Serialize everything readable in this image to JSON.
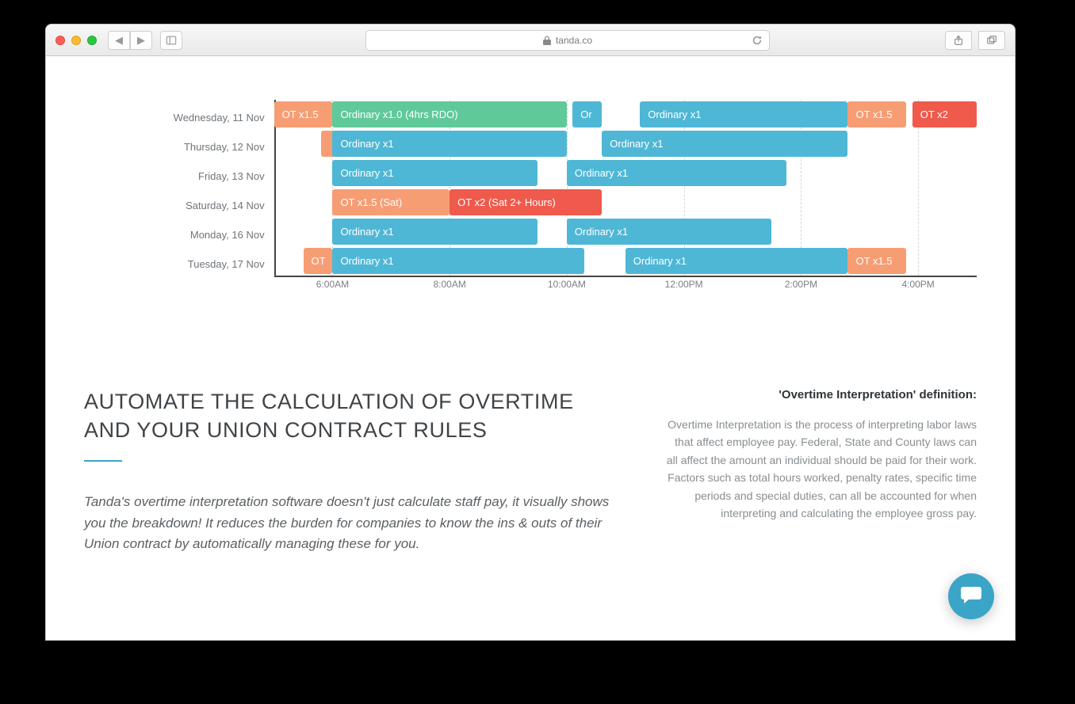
{
  "browser": {
    "url_host": "tanda.co",
    "new_tab": "+"
  },
  "chart_data": {
    "type": "gantt",
    "x_unit": "time",
    "x_range_hours": [
      5,
      17
    ],
    "time_ticks": [
      "6:00AM",
      "8:00AM",
      "10:00AM",
      "12:00PM",
      "2:00PM",
      "4:00PM"
    ],
    "time_tick_hours": [
      6,
      8,
      10,
      12,
      14,
      16
    ],
    "colors": {
      "ordinary": "#4fb7d6",
      "ot15": "#f79d74",
      "ot2": "#ef5a4c",
      "rdo": "#5fc99a"
    },
    "rows": [
      {
        "label": "Wednesday, 11 Nov",
        "bars": [
          {
            "label": "OT x1.5",
            "start": 5.0,
            "end": 6.0,
            "color": "ot15"
          },
          {
            "label": "Ordinary x1.0 (4hrs RDO)",
            "start": 6.0,
            "end": 10.0,
            "color": "rdo"
          },
          {
            "label": "Or",
            "start": 10.1,
            "end": 10.6,
            "color": "ordinary"
          },
          {
            "label": "Ordinary x1",
            "start": 11.25,
            "end": 14.8,
            "color": "ordinary"
          },
          {
            "label": "OT x1.5",
            "start": 14.8,
            "end": 15.8,
            "color": "ot15"
          },
          {
            "label": "OT x2",
            "start": 15.9,
            "end": 17.0,
            "color": "ot2"
          }
        ]
      },
      {
        "label": "Thursday, 12 Nov",
        "bars": [
          {
            "label": "",
            "start": 5.8,
            "end": 6.0,
            "color": "ot15"
          },
          {
            "label": "Ordinary x1",
            "start": 6.0,
            "end": 10.0,
            "color": "ordinary"
          },
          {
            "label": "Ordinary x1",
            "start": 10.6,
            "end": 14.8,
            "color": "ordinary"
          }
        ]
      },
      {
        "label": "Friday, 13 Nov",
        "bars": [
          {
            "label": "Ordinary x1",
            "start": 6.0,
            "end": 9.5,
            "color": "ordinary"
          },
          {
            "label": "Ordinary x1",
            "start": 10.0,
            "end": 13.75,
            "color": "ordinary"
          }
        ]
      },
      {
        "label": "Saturday, 14 Nov",
        "bars": [
          {
            "label": "OT x1.5 (Sat)",
            "start": 6.0,
            "end": 8.0,
            "color": "ot15"
          },
          {
            "label": "OT x2 (Sat 2+ Hours)",
            "start": 8.0,
            "end": 10.6,
            "color": "ot2"
          }
        ]
      },
      {
        "label": "Monday, 16 Nov",
        "bars": [
          {
            "label": "Ordinary x1",
            "start": 6.0,
            "end": 9.5,
            "color": "ordinary"
          },
          {
            "label": "Ordinary x1",
            "start": 10.0,
            "end": 13.5,
            "color": "ordinary"
          }
        ]
      },
      {
        "label": "Tuesday, 17 Nov",
        "bars": [
          {
            "label": "OT",
            "start": 5.5,
            "end": 6.0,
            "color": "ot15"
          },
          {
            "label": "Ordinary x1",
            "start": 6.0,
            "end": 10.3,
            "color": "ordinary"
          },
          {
            "label": "Ordinary x1",
            "start": 11.0,
            "end": 14.8,
            "color": "ordinary"
          },
          {
            "label": "OT x1.5",
            "start": 14.8,
            "end": 15.8,
            "color": "ot15"
          }
        ]
      }
    ]
  },
  "content": {
    "headline": "Automate the calculation of Overtime and your Union Contract Rules",
    "lead": "Tanda's overtime interpretation software doesn't just calculate staff pay, it visually shows you the breakdown! It reduces the burden for companies to know the ins & outs of their Union contract by automatically managing these for you.",
    "sidebar_title": "'Overtime Interpretation' definition:",
    "sidebar_text": "Overtime Interpretation is the process of interpreting labor laws that affect employee pay. Federal, State and County laws can all affect the amount an individual should be paid for their work. Factors such as total hours worked, penalty rates, specific time periods and special duties, can all be accounted for when interpreting and calculating the employee gross pay."
  }
}
